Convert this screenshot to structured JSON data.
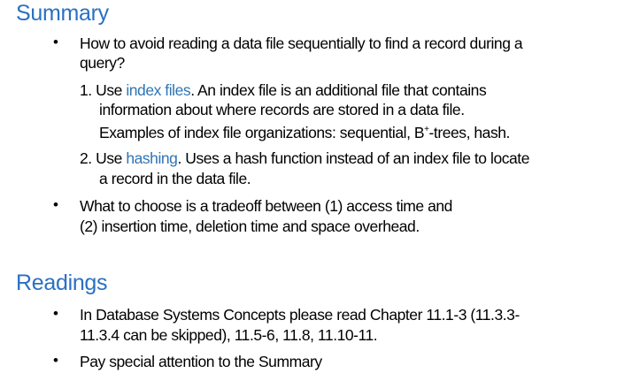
{
  "colors": {
    "heading": "#2a70c2",
    "link": "#2f75b5"
  },
  "summary": {
    "title": "Summary",
    "bullet1": {
      "line1": "How to avoid reading a data file sequentially to find a record during a",
      "line2": "query?"
    },
    "item1": {
      "number": "1.",
      "pre": "Use ",
      "link": "index files",
      "post": ". An index file is an additional file that contains",
      "line2": "information about where records are stored in a data file.",
      "line3_pre": "Examples of index file organizations: sequential, B",
      "line3_sup": "+",
      "line3_post": "-trees, hash."
    },
    "item2": {
      "number": "2.",
      "pre": "Use ",
      "link": "hashing",
      "post": ". Uses a hash function instead of an index file to locate",
      "line2": "a record in the data file."
    },
    "bullet2": {
      "line1": "What to choose is a tradeoff between (1) access time and",
      "line2": "(2) insertion time, deletion time and space overhead."
    }
  },
  "readings": {
    "title": "Readings",
    "bullet1": {
      "line1": "In Database Systems Concepts please read Chapter 11.1-3 (11.3.3-",
      "line2": "11.3.4 can be skipped), 11.5-6, 11.8, 11.10-11."
    },
    "bullet2": {
      "line1": "Pay special attention to the Summary"
    }
  },
  "bullet_char": "•"
}
